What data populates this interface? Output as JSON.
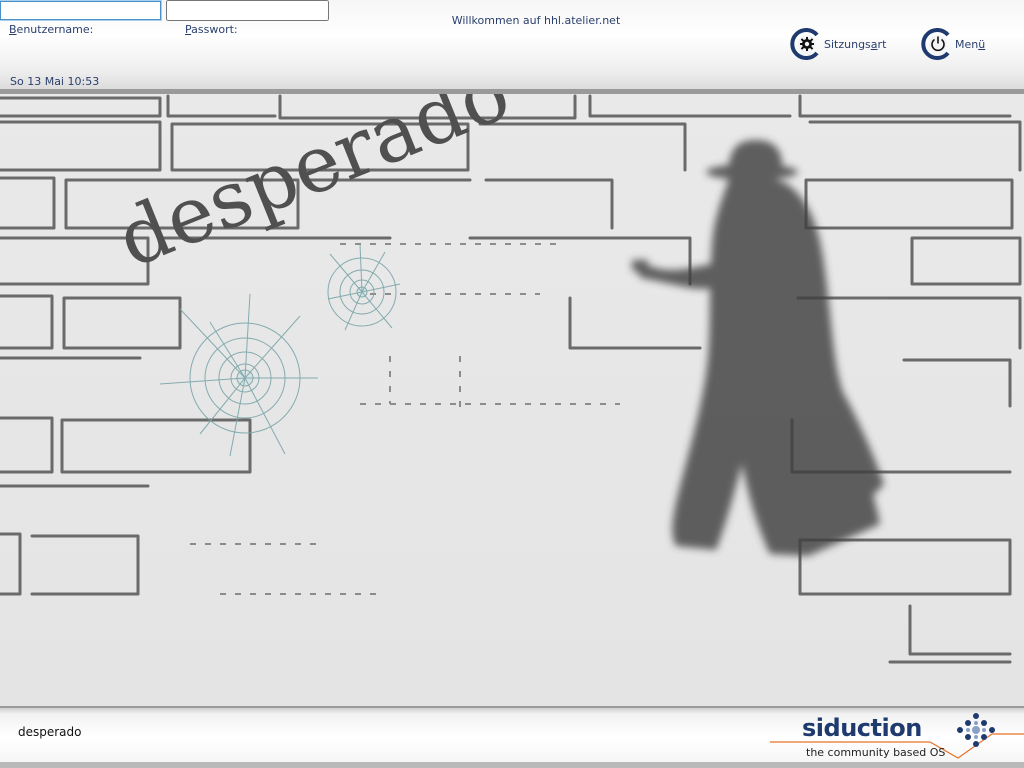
{
  "login": {
    "username_label_first": "B",
    "username_label_rest": "enutzername:",
    "password_label_first": "P",
    "password_label_rest": "asswort:",
    "username_value": "",
    "password_value": ""
  },
  "header": {
    "welcome": "Willkommen auf hhl.atelier.net",
    "clock": "So 13 Mai 10:53"
  },
  "buttons": {
    "session_label_a": "Sitzungs",
    "session_label_b": "a",
    "session_label_c": "rt",
    "menu_label_a": "Men",
    "menu_label_b": "ü"
  },
  "theme": {
    "title": "desperado"
  },
  "footer": {
    "session_name": "desperado",
    "brand": "siduction",
    "tagline": "the community based OS"
  },
  "colors": {
    "label_blue": "#2a3f6e",
    "field_yellow": "#fdfbb6",
    "brand_navy": "#1e3a6e",
    "brand_orange": "#e8742a"
  },
  "icons": {
    "session": "gear-icon",
    "menu": "power-icon",
    "brand_logo": "dot-grid-icon"
  }
}
